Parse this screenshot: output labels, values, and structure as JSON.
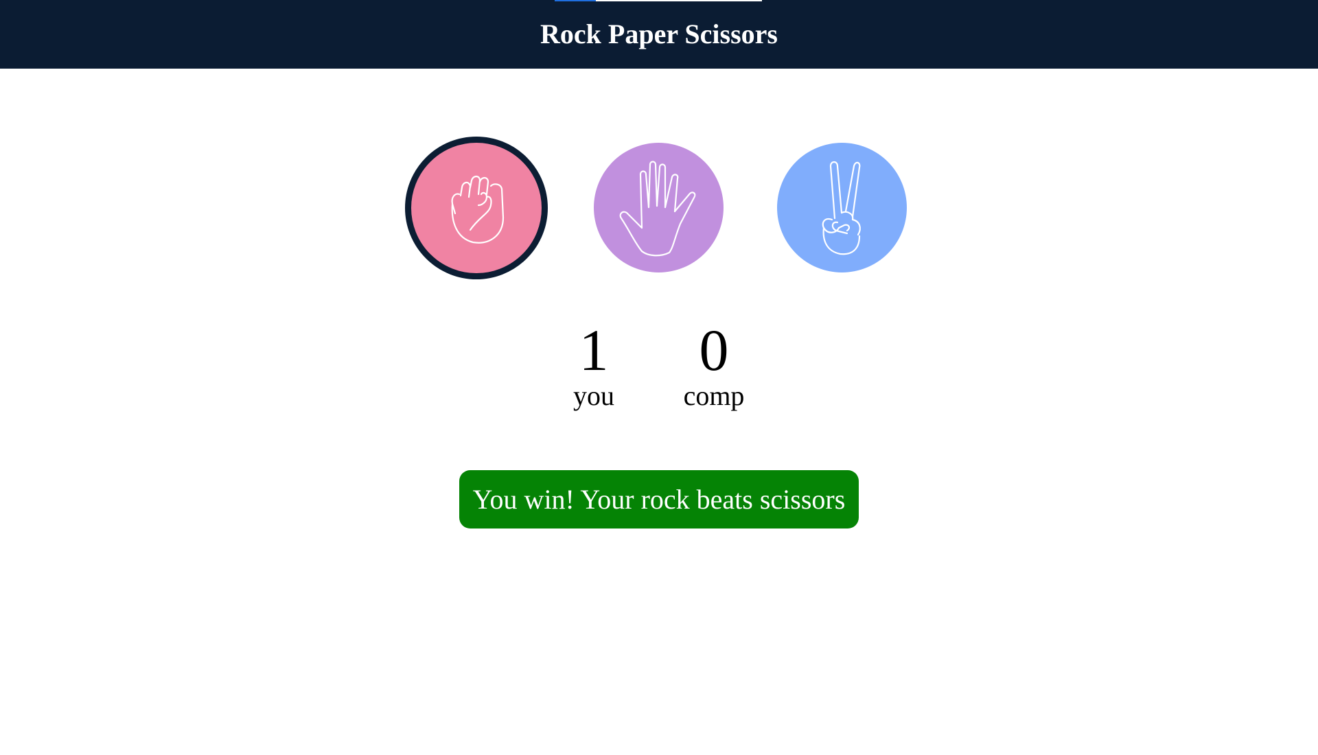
{
  "header": {
    "title": "Rock Paper Scissors",
    "background_color": "#0b1c33"
  },
  "choices": [
    {
      "name": "rock",
      "icon": "fist-icon",
      "color": "#f083a3",
      "selected": true
    },
    {
      "name": "paper",
      "icon": "open-hand-icon",
      "color": "#c190de",
      "selected": false
    },
    {
      "name": "scissors",
      "icon": "peace-hand-icon",
      "color": "#80adfc",
      "selected": false
    }
  ],
  "scoreboard": {
    "you": {
      "value": "1",
      "label": "you"
    },
    "comp": {
      "value": "0",
      "label": "comp"
    }
  },
  "result": {
    "message": "You win! Your rock beats scissors",
    "color": "#058305"
  }
}
